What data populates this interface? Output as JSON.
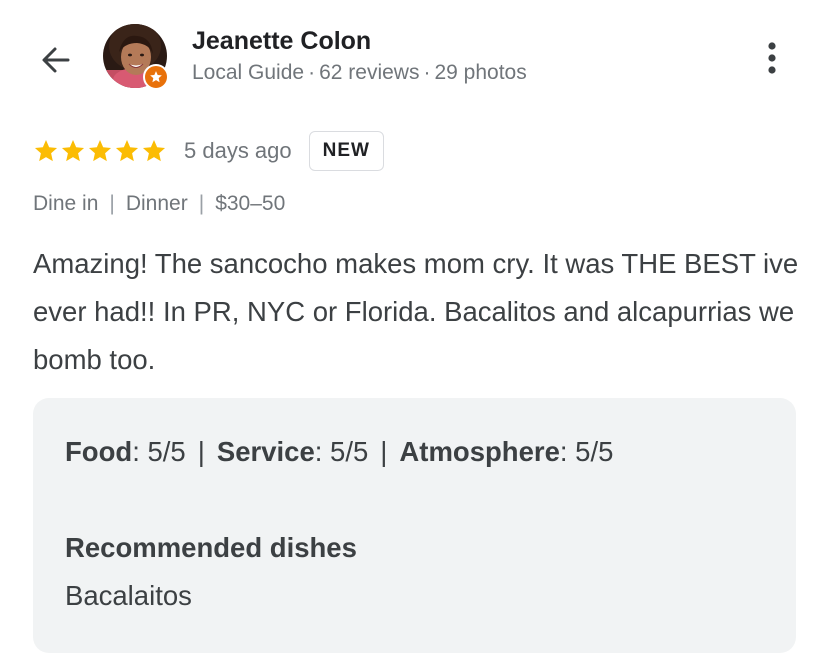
{
  "reviewer": {
    "name": "Jeanette Colon",
    "guide_label": "Local Guide",
    "reviews_count": "62 reviews",
    "photos_count": "29 photos",
    "separator": "·"
  },
  "icons": {
    "back": "arrow-left-icon",
    "more": "more-vert-icon",
    "star": "star-icon",
    "badge": "local-guide-star-icon"
  },
  "colors": {
    "star": "#fbbc04",
    "badge": "#e8710a",
    "card_bg": "#f1f3f4",
    "secondary_text": "#70757a"
  },
  "rating": {
    "stars": 5,
    "max_stars": 5,
    "time": "5 days ago",
    "badge": "NEW"
  },
  "tags": {
    "items": [
      "Dine in",
      "Dinner",
      "$30–50"
    ],
    "separator": "|"
  },
  "review": {
    "text": "Amazing! The sancocho makes mom cry. It was THE BEST ive ever had!! In PR, NYC or Florida. Bacalitos and alcapurrias we bomb too."
  },
  "details": {
    "scores": [
      {
        "label": "Food",
        "value": "5/5"
      },
      {
        "label": "Service",
        "value": "5/5"
      },
      {
        "label": "Atmosphere",
        "value": "5/5"
      }
    ],
    "separator": "|",
    "recommended_title": "Recommended dishes",
    "recommended_value": "Bacalaitos"
  }
}
